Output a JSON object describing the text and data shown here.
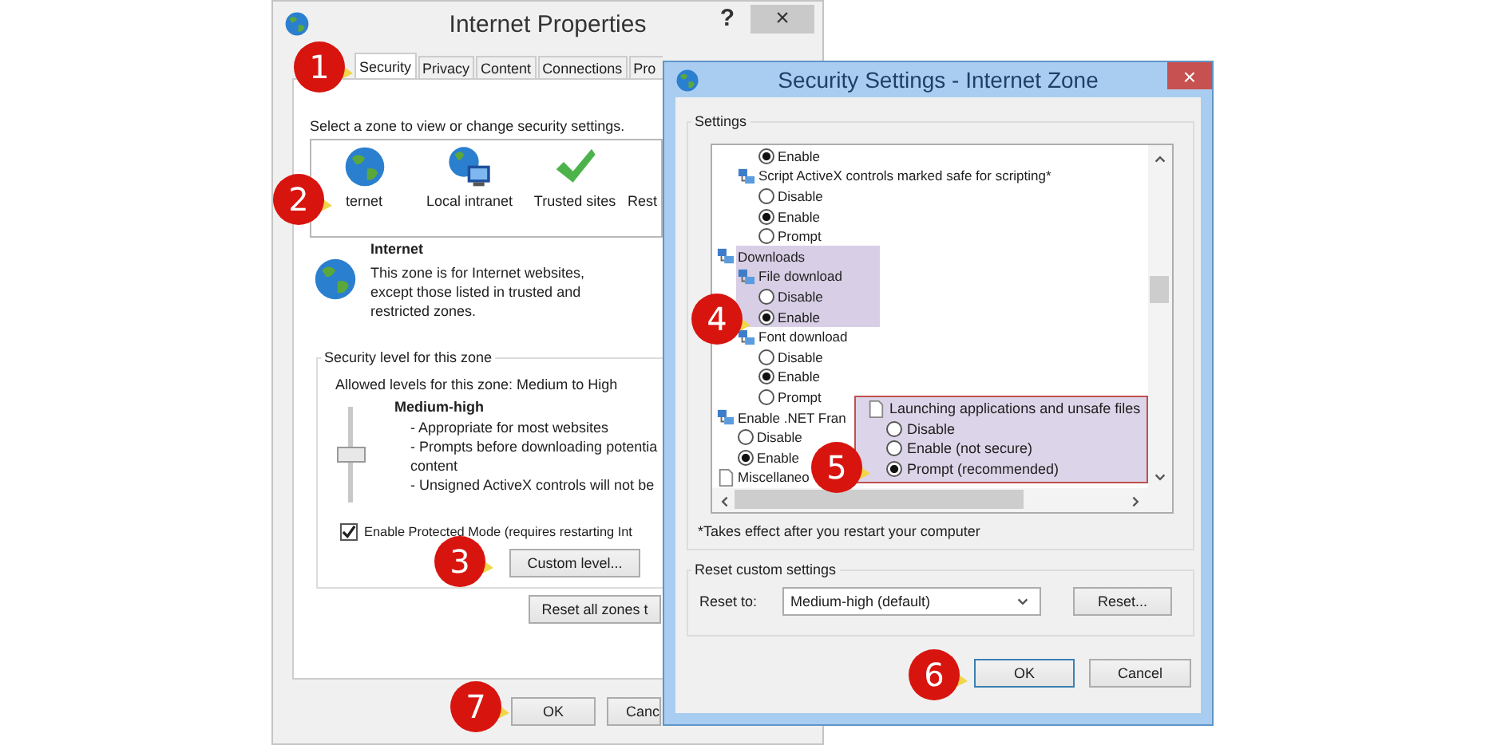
{
  "back_window": {
    "title": "Internet Properties",
    "help": "?",
    "close": "×",
    "tabs": [
      {
        "label": "Security",
        "selected": true
      },
      {
        "label": "Privacy",
        "selected": false
      },
      {
        "label": "Content",
        "selected": false
      },
      {
        "label": "Connections",
        "selected": false
      },
      {
        "label": "Pro",
        "selected": false
      }
    ],
    "zone_prompt": "Select a zone to view or change security settings.",
    "zones": [
      {
        "label": "ternet",
        "kind": "globe"
      },
      {
        "label": "Local intranet",
        "kind": "network"
      },
      {
        "label": "Trusted sites",
        "kind": "check"
      },
      {
        "label": "Rest",
        "kind": "restricted"
      }
    ],
    "zone_info": {
      "title": "Internet",
      "description": "This zone is for Internet websites,\nexcept those listed in trusted and\nrestricted zones."
    },
    "level_group": {
      "legend": "Security level for this zone",
      "allowed": "Allowed levels for this zone: Medium to High",
      "level": 0.5,
      "level_name": "Medium-high",
      "details": "- Appropriate for most websites\n- Prompts before downloading potentia\ncontent\n- Unsigned ActiveX controls will not be"
    },
    "protected_mode": {
      "label": "Enable Protected Mode (requires restarting Int",
      "checked": true
    },
    "custom_button": "Custom level...",
    "reset_all_button": "Reset all zones t",
    "ok": "OK",
    "cancel": "Canc"
  },
  "front_window": {
    "title": "Security Settings - Internet Zone",
    "settings_legend": "Settings",
    "tree": [
      {
        "kind": "option",
        "label": "Enable",
        "selected": true
      },
      {
        "kind": "setting",
        "label": "Script ActiveX controls marked safe for scripting*",
        "highlighted": false,
        "children": [
          {
            "kind": "option",
            "label": "Disable",
            "selected": false
          },
          {
            "kind": "option",
            "label": "Enable",
            "selected": true
          },
          {
            "kind": "option",
            "label": "Prompt",
            "selected": false
          }
        ]
      },
      {
        "kind": "category",
        "label": "Downloads",
        "highlighted": true,
        "children": [
          {
            "kind": "setting",
            "label": "File download",
            "highlighted": true,
            "children": [
              {
                "kind": "option",
                "label": "Disable",
                "selected": false
              },
              {
                "kind": "option",
                "label": "Enable",
                "selected": true
              }
            ]
          },
          {
            "kind": "setting",
            "label": "Font download",
            "highlighted": false,
            "children": [
              {
                "kind": "option",
                "label": "Disable",
                "selected": false
              },
              {
                "kind": "option",
                "label": "Enable",
                "selected": true
              },
              {
                "kind": "option",
                "label": "Prompt",
                "selected": false
              }
            ]
          }
        ]
      },
      {
        "kind": "category",
        "label": "Enable .NET Fran",
        "highlighted": false,
        "children": [
          {
            "kind": "option",
            "label": "Disable",
            "selected": false
          },
          {
            "kind": "option",
            "label": "Enable",
            "selected": true
          }
        ]
      },
      {
        "kind": "category",
        "label": "Miscellaneo",
        "highlighted": false
      }
    ],
    "popup": {
      "title": "Launching applications and unsafe files",
      "options": [
        {
          "label": "Disable",
          "selected": false
        },
        {
          "label": "Enable (not secure)",
          "selected": false
        },
        {
          "label": "Prompt (recommended)",
          "selected": true
        }
      ]
    },
    "note": "*Takes effect after you restart your computer",
    "reset_legend": "Reset custom settings",
    "reset_to_label": "Reset to:",
    "reset_to_value": "Medium-high (default)",
    "reset_button": "Reset...",
    "ok": "OK",
    "cancel": "Cancel"
  },
  "callouts": [
    "1",
    "2",
    "3",
    "4",
    "5",
    "6",
    "7"
  ]
}
